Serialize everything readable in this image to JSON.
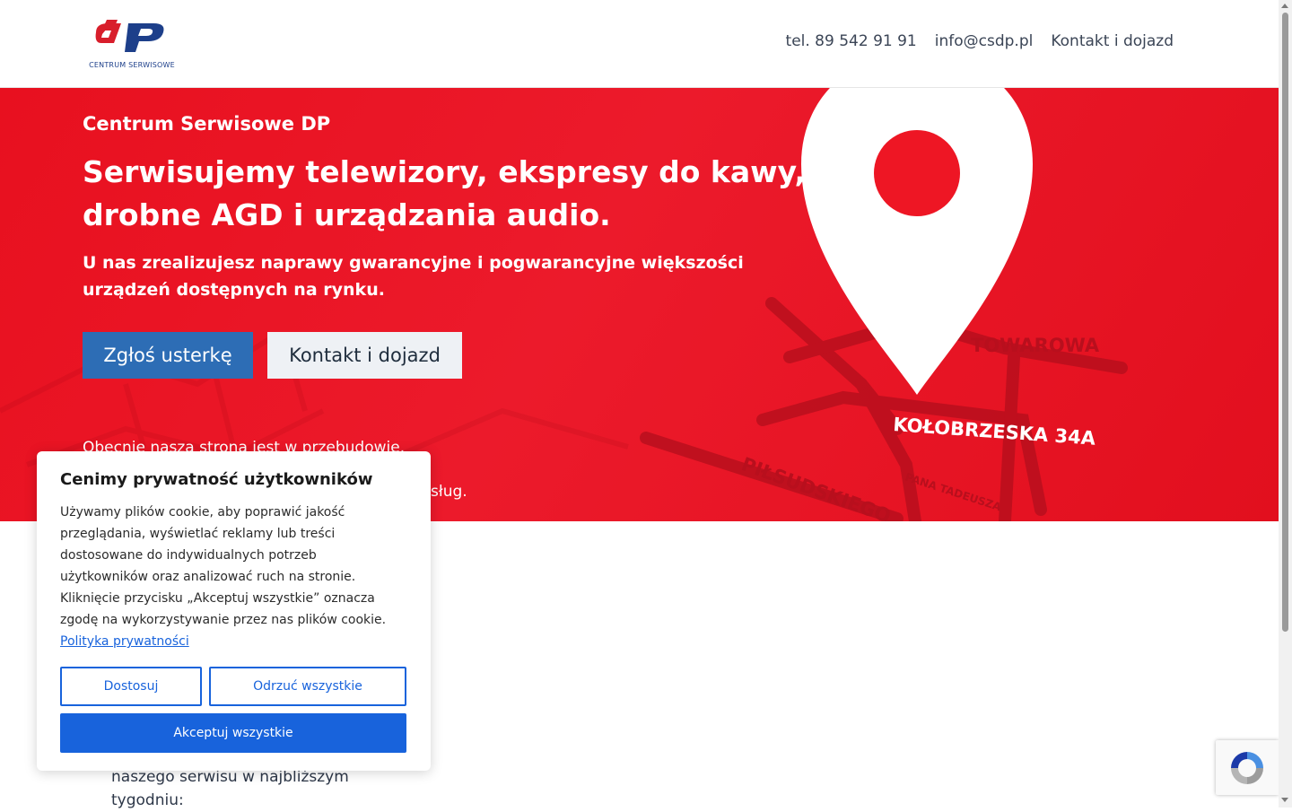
{
  "header": {
    "logo_text": "CENTRUM SERWISOWE",
    "logo_mark": "dp",
    "nav": {
      "phone": "tel. 89 542 91 91",
      "email": "info@csdp.pl",
      "contact": "Kontakt i dojazd"
    }
  },
  "hero": {
    "subtitle": "Centrum Serwisowe DP",
    "title": "Serwisujemy telewizory, ekspresy do kawy, drobne AGD i urządzania audio.",
    "lead": "U nas zrealizujesz naprawy gwarancyjne i pogwarancyjne większości urządzeń dostępnych na rynku.",
    "btn_report": "Zgłoś usterkę",
    "btn_contact": "Kontakt i dojazd",
    "note_line1": "Obecnie nasza strona jest w przebudowie.",
    "note_line2": "sług.",
    "map_labels": {
      "street1": "TOWAROWA",
      "street2": "KOŁOBRZESKA 34A",
      "street3": "PIŁSUDSKIEGO",
      "street4": "PANA TADEUSZA"
    }
  },
  "below": {
    "text": "naszego serwisu w najbliższym tygodniu:"
  },
  "cookie": {
    "title": "Cenimy prywatność użytkowników",
    "text": "Używamy plików cookie, aby poprawić jakość przeglądania, wyświetlać reklamy lub treści dostosowane do indywidualnych potrzeb użytkowników oraz analizować ruch na stronie. Kliknięcie przycisku „Akceptuj wszystkie” oznacza zgodę na wykorzystywanie przez nas plików cookie.",
    "policy_link": "Polityka prywatności",
    "btn_customize": "Dostosuj",
    "btn_reject": "Odrzuć wszystkie",
    "btn_accept": "Akceptuj wszystkie"
  },
  "colors": {
    "hero_red": "#e8101f",
    "primary_blue": "#2d6db5",
    "cookie_blue": "#1863dc",
    "logo_red": "#d81e2b",
    "logo_blue": "#1d3f8a"
  }
}
